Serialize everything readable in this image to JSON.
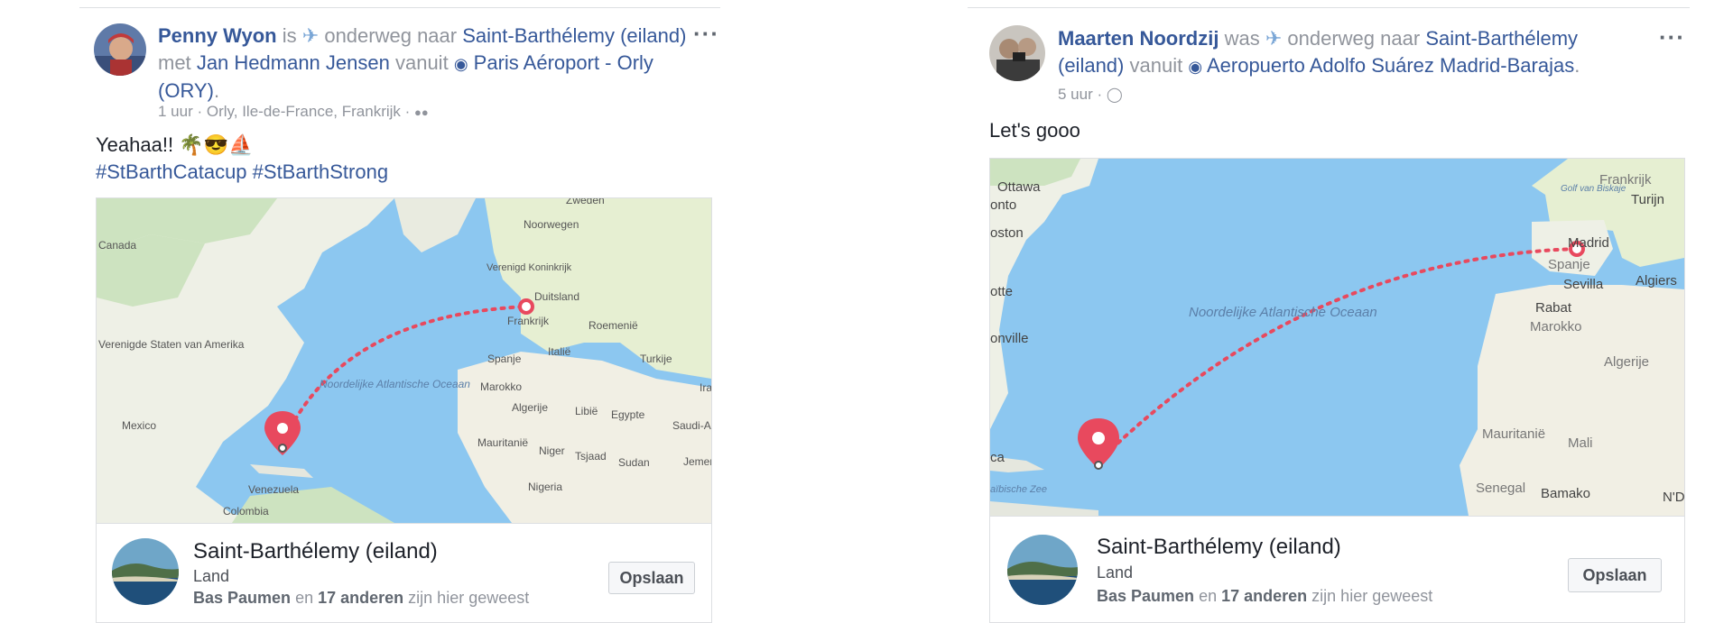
{
  "posts": [
    {
      "author": "Penny Wyon",
      "verb": "is",
      "travel_icon": "airplane-icon",
      "travel_phrase": "onderweg naar",
      "destination": "Saint-Barthélemy (eiland)",
      "with_word": "met",
      "companion": "Jan Hedmann Jensen",
      "from_word": "vanuit",
      "origin": "Paris Aéroport - Orly (ORY)",
      "meta": "1 uur · Orly, Ile-de-France, Frankrijk ·",
      "audience_icon": "friends-icon",
      "text_line1": "Yeahaa!! 🌴😎⛵",
      "text_line2": "#StBarthCatacup #StBarthStrong",
      "map_labels": [
        "Canada",
        "Zweden",
        "Noorwegen",
        "Verenigd Koninkrijk",
        "Duitsland",
        "Frankrijk",
        "Roemenië",
        "Spanje",
        "Italië",
        "Turkije",
        "Irak",
        "Verenigde Staten van Amerika",
        "Noordelijke Atlantische Oceaan",
        "Marokko",
        "Algerije",
        "Libië",
        "Egypte",
        "Mexico",
        "Mauritanië",
        "Niger",
        "Tsjaad",
        "Sudan",
        "Saudi-Arabië",
        "Jemen",
        "Venezuela",
        "Nigeria",
        "Colombia"
      ],
      "place_title": "Saint-Barthélemy (eiland)",
      "place_type": "Land",
      "visit_person": "Bas Paumen",
      "visit_and": "en",
      "visit_others": "17 anderen",
      "visit_suffix": "zijn hier geweest",
      "save_label": "Opslaan"
    },
    {
      "author": "Maarten Noordzij",
      "verb": "was",
      "travel_icon": "airplane-icon",
      "travel_phrase": "onderweg naar",
      "destination": "Saint-Barthélemy (eiland)",
      "from_word": "vanuit",
      "origin": "Aeropuerto Adolfo Suárez Madrid-Barajas",
      "meta": "5 uur ·",
      "audience_icon": "globe-icon",
      "text_line1": "Let's gooo",
      "map_labels": [
        "Ottawa",
        "onto",
        "oston",
        "otte",
        "onville",
        "Noordelijke Atlantische Oceaan",
        "Frankrijk",
        "Golf van Biskaje",
        "Turijn",
        "Madrid",
        "Spanje",
        "Sevilla",
        "Algiers",
        "Rabat",
        "Marokko",
        "Algerije",
        "Mauritanië",
        "Mali",
        "Senegal",
        "Bamako",
        "N'Dj",
        "ca",
        "aïbische Zee"
      ],
      "place_title": "Saint-Barthélemy (eiland)",
      "place_type": "Land",
      "visit_person": "Bas Paumen",
      "visit_and": "en",
      "visit_others": "17 anderen",
      "visit_suffix": "zijn hier geweest",
      "save_label": "Opslaan"
    }
  ],
  "colors": {
    "link": "#365899",
    "muted": "#90949c",
    "route": "#e8495e",
    "ocean": "#8cc7f0",
    "land": "#eef0e6"
  }
}
